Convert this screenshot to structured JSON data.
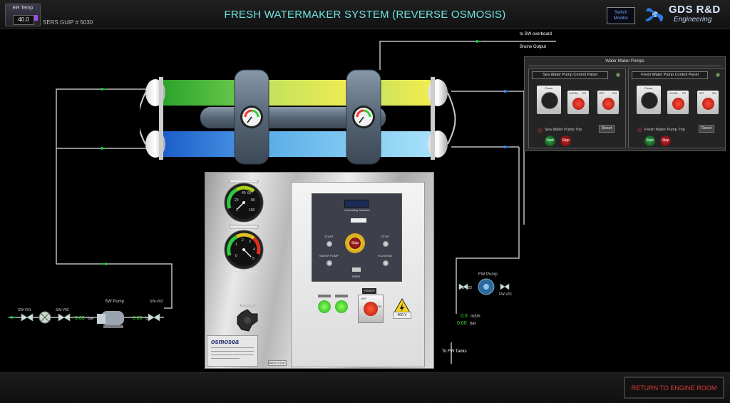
{
  "header": {
    "title": "FRESH WATERMAKER SYSTEM (REVERSE OSMOSIS)",
    "er_temp_label": "ER Temp",
    "er_temp_value": "40.0",
    "sers_label": "SERS GUIP # 5030",
    "switch_monitor": "Switch Monitor",
    "brand_top": "GDS R&D",
    "brand_bottom": "Engineering"
  },
  "footer": {
    "return_button": "RETURN TO ENGINE ROOM"
  },
  "flow_labels": {
    "to_sw_overboard": "to SW overboard",
    "bruine_output": "Bruine Output",
    "to_fw_tanks": "To FW Tanks"
  },
  "sea_water_line": {
    "sw_v01": "SW-V01",
    "sw_v02": "SW-V02",
    "sw_v03": "SW-V03",
    "sw_pump": "SW Pump",
    "pressure_before": "0.00",
    "pressure_after": "0.00",
    "unit": "bar"
  },
  "fresh_water_line": {
    "fw_pump": "FW Pump",
    "fw_v01": "FW-V01",
    "fw_v02": "FW-V02",
    "flow_value": "0.0",
    "flow_unit": "m3/h",
    "pressure_value": "0.00",
    "pressure_unit": "bar"
  },
  "pumps_panel": {
    "title": "Water Maker Pumps",
    "sea_water": {
      "title": "Sea Water  Pump Control Panel",
      "power_label": "Power",
      "local_label": "LOCAL",
      "remote_label": "RT",
      "off_label": "OFF",
      "on_label": "ON",
      "trip_label": "Sea Water Pump Trip",
      "reset": "Reset",
      "start": "Start",
      "stop": "Stop"
    },
    "fresh_water": {
      "title": "Fresh Water  Pump Control Panel",
      "power_label": "Power",
      "local_label": "LOCAL",
      "remote_label": "RT",
      "off_label": "OFF",
      "on_label": "ON",
      "trip_label": "Fresh Water Pump Trip",
      "reset": "Reset",
      "start": "Start",
      "stop": "Stop"
    }
  },
  "gauges": {
    "upper_ticks": [
      "40",
      "60",
      "20",
      "80",
      "0",
      "100"
    ],
    "lower_ticks": [
      "2",
      "3",
      "4",
      "1",
      "5",
      "0"
    ]
  },
  "control_box": {
    "brand_plate": "osmosea",
    "made_in": "MADE in ITALY",
    "panel_caption": "Controlling Software",
    "start": "START",
    "stop": "STOP",
    "water_pump": "WATER PUMP",
    "flushing": "FLUSHING",
    "timer": "TIMER",
    "emergency_stop": "Stop",
    "power": "POWER",
    "off": "OFF",
    "on": "ON",
    "voltage": "400 V"
  },
  "colors": {
    "title": "#6ee3e0",
    "green_membrane": "#4cc94c",
    "yellow_membrane": "#e8e34a",
    "blue_membrane": "#2a7ad8",
    "light_blue_membrane": "#7ad0f2",
    "pipe": "#c0c0c0",
    "flow_arrow": "#22cc44",
    "return_text": "#d83a34"
  }
}
